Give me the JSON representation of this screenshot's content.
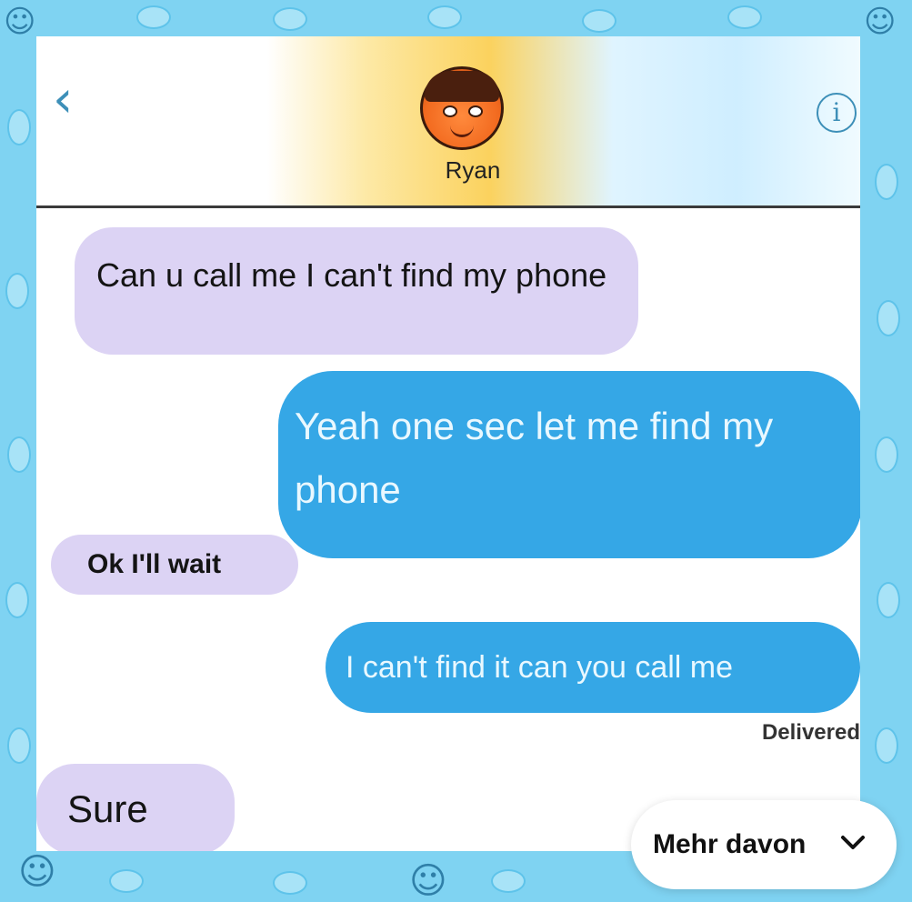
{
  "header": {
    "back_icon": "chevron-left-icon",
    "contact_name": "Ryan",
    "info_icon": "info-icon",
    "info_glyph": "i"
  },
  "messages": [
    {
      "direction": "incoming",
      "text": "Can u call me I can't find my phone"
    },
    {
      "direction": "outgoing",
      "text": "Yeah one sec let me find my phone"
    },
    {
      "direction": "incoming",
      "text": "Ok I'll wait"
    },
    {
      "direction": "outgoing",
      "text": "I can't find it can you call me"
    },
    {
      "direction": "incoming",
      "text": "Sure"
    }
  ],
  "status": {
    "delivered": "Delivered"
  },
  "more_button": {
    "label": "Mehr davon",
    "icon": "chevron-down-icon"
  },
  "colors": {
    "incoming_bubble": "#dcd3f4",
    "outgoing_bubble": "#35a7e6",
    "frame": "#7fd3f2",
    "accent": "#3d8fb8"
  }
}
